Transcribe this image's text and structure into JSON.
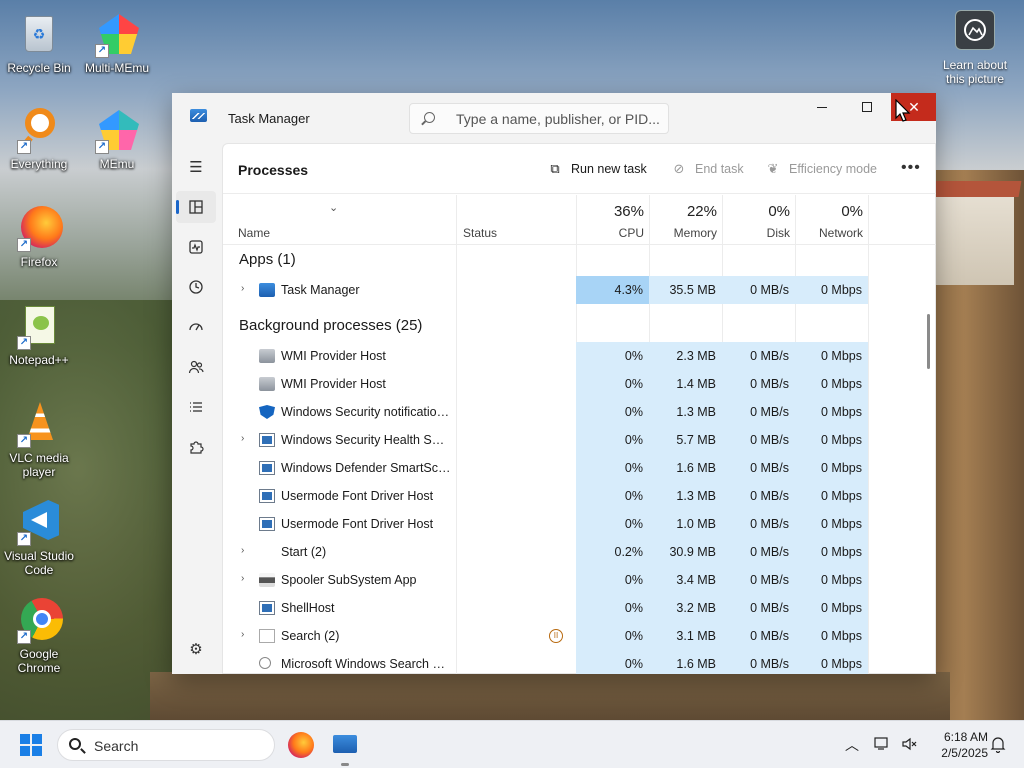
{
  "desktop": {
    "icons": [
      {
        "label": "Recycle Bin"
      },
      {
        "label": "Multi-MEmu"
      },
      {
        "label": "Everything"
      },
      {
        "label": "MEmu"
      },
      {
        "label": "Firefox"
      },
      {
        "label": "Notepad++"
      },
      {
        "label": "VLC media player"
      },
      {
        "label": "Visual Studio Code"
      },
      {
        "label": "Google Chrome"
      }
    ],
    "learn_label": "Learn about this picture"
  },
  "window": {
    "title": "Task Manager",
    "search_placeholder": "Type a name, publisher, or PID...",
    "page_title": "Processes",
    "commands": {
      "run_new_task": "Run new task",
      "end_task": "End task",
      "efficiency_mode": "Efficiency mode",
      "more": "•••"
    },
    "columns": {
      "name": "Name",
      "status": "Status",
      "cpu_pct": "36%",
      "cpu": "CPU",
      "memory_pct": "22%",
      "memory": "Memory",
      "disk_pct": "0%",
      "disk": "Disk",
      "network_pct": "0%",
      "network": "Network"
    },
    "groups": {
      "apps": "Apps (1)",
      "background": "Background processes (25)"
    },
    "apps": [
      {
        "name": "Task Manager",
        "cpu": "4.3%",
        "mem": "35.5 MB",
        "disk": "0 MB/s",
        "net": "0 Mbps"
      }
    ],
    "background": [
      {
        "name": "WMI Provider Host",
        "cpu": "0%",
        "mem": "2.3 MB",
        "disk": "0 MB/s",
        "net": "0 Mbps"
      },
      {
        "name": "WMI Provider Host",
        "cpu": "0%",
        "mem": "1.4 MB",
        "disk": "0 MB/s",
        "net": "0 Mbps"
      },
      {
        "name": "Windows Security notification...",
        "cpu": "0%",
        "mem": "1.3 MB",
        "disk": "0 MB/s",
        "net": "0 Mbps"
      },
      {
        "name": "Windows Security Health Servi...",
        "cpu": "0%",
        "mem": "5.7 MB",
        "disk": "0 MB/s",
        "net": "0 Mbps"
      },
      {
        "name": "Windows Defender SmartScreen",
        "cpu": "0%",
        "mem": "1.6 MB",
        "disk": "0 MB/s",
        "net": "0 Mbps"
      },
      {
        "name": "Usermode Font Driver Host",
        "cpu": "0%",
        "mem": "1.3 MB",
        "disk": "0 MB/s",
        "net": "0 Mbps"
      },
      {
        "name": "Usermode Font Driver Host",
        "cpu": "0%",
        "mem": "1.0 MB",
        "disk": "0 MB/s",
        "net": "0 Mbps"
      },
      {
        "name": "Start (2)",
        "cpu": "0.2%",
        "mem": "30.9 MB",
        "disk": "0 MB/s",
        "net": "0 Mbps"
      },
      {
        "name": "Spooler SubSystem App",
        "cpu": "0%",
        "mem": "3.4 MB",
        "disk": "0 MB/s",
        "net": "0 Mbps"
      },
      {
        "name": "ShellHost",
        "cpu": "0%",
        "mem": "3.2 MB",
        "disk": "0 MB/s",
        "net": "0 Mbps"
      },
      {
        "name": "Search (2)",
        "cpu": "0%",
        "mem": "3.1 MB",
        "disk": "0 MB/s",
        "net": "0 Mbps"
      },
      {
        "name": "Microsoft Windows Search Pr...",
        "cpu": "0%",
        "mem": "1.6 MB",
        "disk": "0 MB/s",
        "net": "0 Mbps"
      }
    ]
  },
  "taskbar": {
    "search_label": "Search",
    "time": "6:18 AM",
    "date": "2/5/2025"
  },
  "colors": {
    "accent": "#1a66c9",
    "close_red": "#c42b1c",
    "heat_light": "#d7ecfb",
    "heat_dark": "#a8d4f6"
  }
}
